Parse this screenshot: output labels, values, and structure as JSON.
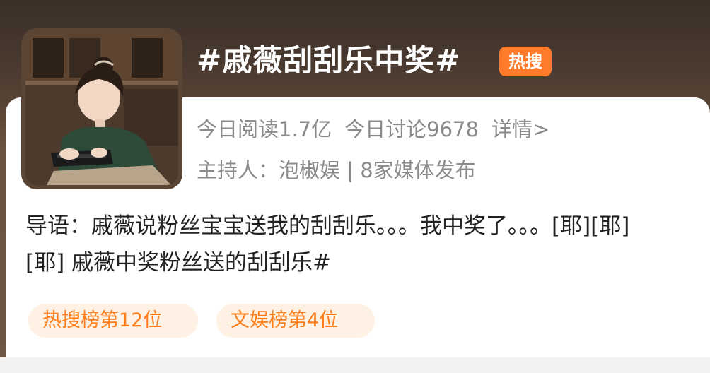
{
  "topic": {
    "title": "#戚薇刮刮乐中奖#",
    "badge": "热搜"
  },
  "stats": {
    "reads": "今日阅读1.7亿",
    "discussions": "今日讨论9678",
    "details_link": "详情>"
  },
  "host": {
    "text": "主持人：泡椒娱 | 8家媒体发布"
  },
  "intro": {
    "text": "导语：戚薇说粉丝宝宝送我的刮刮乐。。。我中奖了。。。[耶][耶][耶] 戚薇中奖粉丝送的刮刮乐#"
  },
  "rank_tags": [
    {
      "label": "热搜榜第12位"
    },
    {
      "label": "文娱榜第4位"
    }
  ],
  "colors": {
    "accent": "#ff7a2a",
    "tag_text": "#ff7d1a",
    "tag_bg": "#fff1e4",
    "secondary_text": "#8a8a8a"
  }
}
